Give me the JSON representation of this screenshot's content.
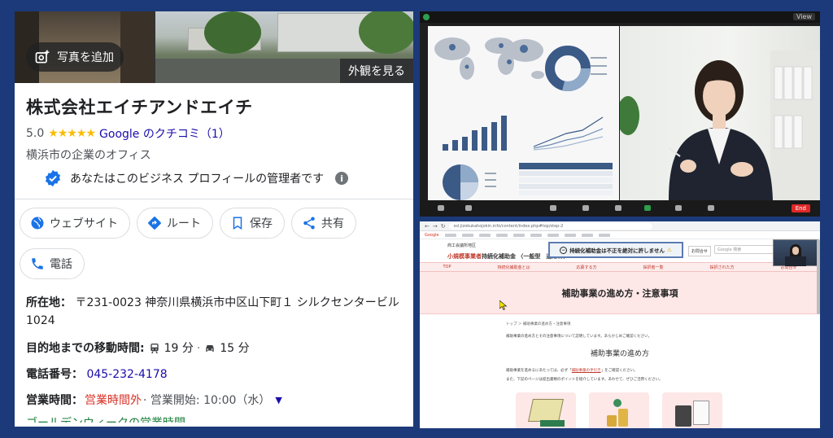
{
  "profile": {
    "add_photo_label": "写真を追加",
    "view_exterior_label": "外観を見る",
    "business_name": "株式会社エイチアンドエイチ",
    "rating": "5.0",
    "stars": "★★★★★",
    "reviews_link": "Google のクチコミ（1）",
    "category": "横浜市の企業のオフィス",
    "manager_note": "あなたはこのビジネス プロフィールの管理者です",
    "info_glyph": "i",
    "actions": {
      "website": "ウェブサイト",
      "route": "ルート",
      "save": "保存",
      "share": "共有",
      "call": "電話"
    },
    "address_label": "所在地：",
    "address_value": "〒231-0023 神奈川県横浜市中区山下町１ シルクセンタービル 1024",
    "travel_label": "目的地までの移動時間:",
    "travel_train": "19 分",
    "travel_separator": "·",
    "travel_car": "15 分",
    "phone_label": "電話番号：",
    "phone_value": "045-232-4178",
    "hours_label": "営業時間：",
    "hours_status": "営業時間外",
    "hours_next": "· 営業開始: 10:00（水）",
    "cut_off_text": "ゴールデンウィークの営業時間"
  },
  "video_call": {
    "view_label": "View",
    "end_label": "End"
  },
  "browser": {
    "url": "ssl.jizokukahojokin.info/content/index.php#top/step-2",
    "bookmark_google": "Google",
    "logo_small": "商工会議所地区",
    "logo_brand": "小規模事業者",
    "logo_rest": "持続化補助金 〈一般型　通常枠〉",
    "banner_text": "持続化補助金は不正を絶対に許しません",
    "contact_label": "お問合せ",
    "search_placeholder": "Google 検索",
    "nav": [
      "TOP",
      "持続化補助金とは",
      "応募する方",
      "採択者一覧",
      "採択された方",
      "お問合せ"
    ],
    "hero_title": "補助事業の進め方・注意事項",
    "breadcrumb": "トップ ＞ 補助事業の進め方・注意事項",
    "intro": "補助事業の進め方とその注意事項について説明しています。あらかじめご確認ください。",
    "section_title": "補助事業の進め方",
    "body_prefix": "補助事業を進めるにあたっては、必ず「",
    "body_link": "補助事業の手引き",
    "body_suffix": "」をご確認ください。",
    "body_line2": "また、下記のページは提出書類のポイントを紹介しています。あわせて、ぜひご活用ください。"
  },
  "colors": {
    "background": "#1c3a7a",
    "link": "#1a0dab",
    "closed": "#d93025",
    "star": "#fbbc04"
  }
}
